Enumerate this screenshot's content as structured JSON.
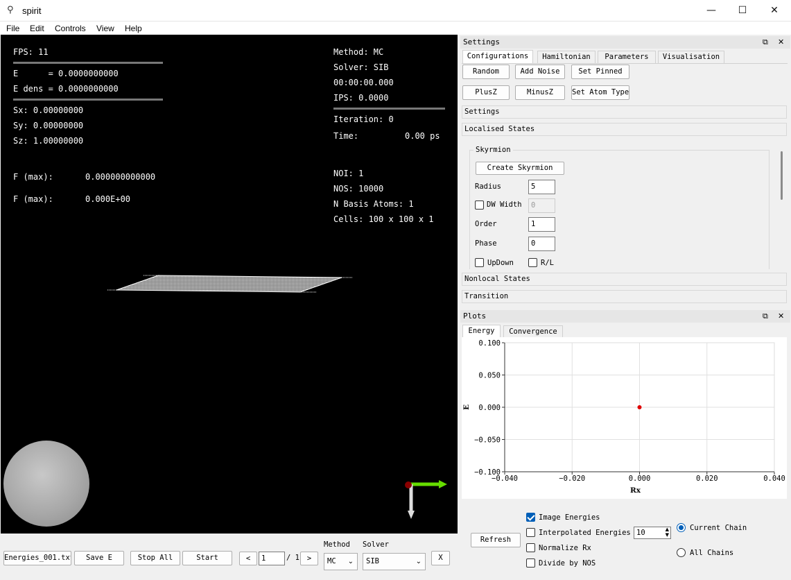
{
  "window": {
    "title": "spirit"
  },
  "menu": [
    "File",
    "Edit",
    "Controls",
    "View",
    "Help"
  ],
  "viewport": {
    "fps": "FPS: 11",
    "e": "E      = 0.0000000000",
    "e_dens": "E dens = 0.0000000000",
    "sx": "Sx: 0.00000000",
    "sy": "Sy: 0.00000000",
    "sz": "Sz: 1.00000000",
    "fmax1_label": "F (max):",
    "fmax1_value": "0.000000000000",
    "fmax2_label": "F (max):",
    "fmax2_value": "0.000E+00",
    "method": "Method: MC",
    "solver": "Solver: SIB",
    "time_elapsed": "00:00:00.000",
    "ips": "IPS: 0.0000",
    "iteration": "Iteration: 0",
    "time_label": "Time:",
    "time_value": "0.00 ps",
    "noi": "NOI: 1",
    "nos": "NOS: 10000",
    "basis": "N Basis Atoms: 1",
    "cells": "Cells: 100 x 100 x 1"
  },
  "bottom": {
    "file_button": "Energies_001.txt",
    "save_e": "Save E",
    "stop_all": "Stop All",
    "start": "Start",
    "prev": "<",
    "image_index": "1",
    "image_total": "/ 1",
    "next": ">",
    "method_label": "Method",
    "method_value": "MC",
    "solver_label": "Solver",
    "solver_value": "SIB",
    "x_button": "X"
  },
  "settings": {
    "header": "Settings",
    "tabs": [
      "Configurations",
      "Hamiltonian",
      "Parameters",
      "Visualisation"
    ],
    "buttons_row1": [
      "Random",
      "Add Noise",
      "Set Pinned"
    ],
    "buttons_row2": [
      "PlusZ",
      "MinusZ",
      "Set Atom Type"
    ],
    "sections": {
      "settings": "Settings",
      "localised": "Localised States",
      "nonlocal": "Nonlocal States",
      "transition": "Transition"
    },
    "skyrmion": {
      "group": "Skyrmion",
      "create": "Create Skyrmion",
      "radius_label": "Radius",
      "radius_value": "5",
      "dw_label": "DW Width",
      "dw_value": "0",
      "order_label": "Order",
      "order_value": "1",
      "phase_label": "Phase",
      "phase_value": "0",
      "updown": "UpDown",
      "rl": "R/L"
    }
  },
  "plots": {
    "header": "Plots",
    "tabs": [
      "Energy",
      "Convergence"
    ],
    "refresh": "Refresh",
    "image_energies": "Image Energies",
    "interpolated": "Interpolated Energies",
    "interp_value": "10",
    "normalize": "Normalize Rx",
    "divide": "Divide by NOS",
    "current_chain": "Current Chain",
    "all_chains": "All Chains"
  },
  "chart_data": {
    "type": "scatter",
    "xlabel": "Rx",
    "ylabel": "E",
    "xlim": [
      -0.04,
      0.04
    ],
    "ylim": [
      -0.1,
      0.1
    ],
    "x_ticks": [
      "-0.040",
      "-0.020",
      "0.000",
      "0.020",
      "0.040"
    ],
    "y_ticks": [
      "0.100",
      "0.050",
      "0.000",
      "-0.050",
      "-0.100"
    ],
    "grid": true,
    "points": [
      {
        "x": 0.0,
        "y": 0.0
      }
    ],
    "point_color": "#e00000"
  }
}
